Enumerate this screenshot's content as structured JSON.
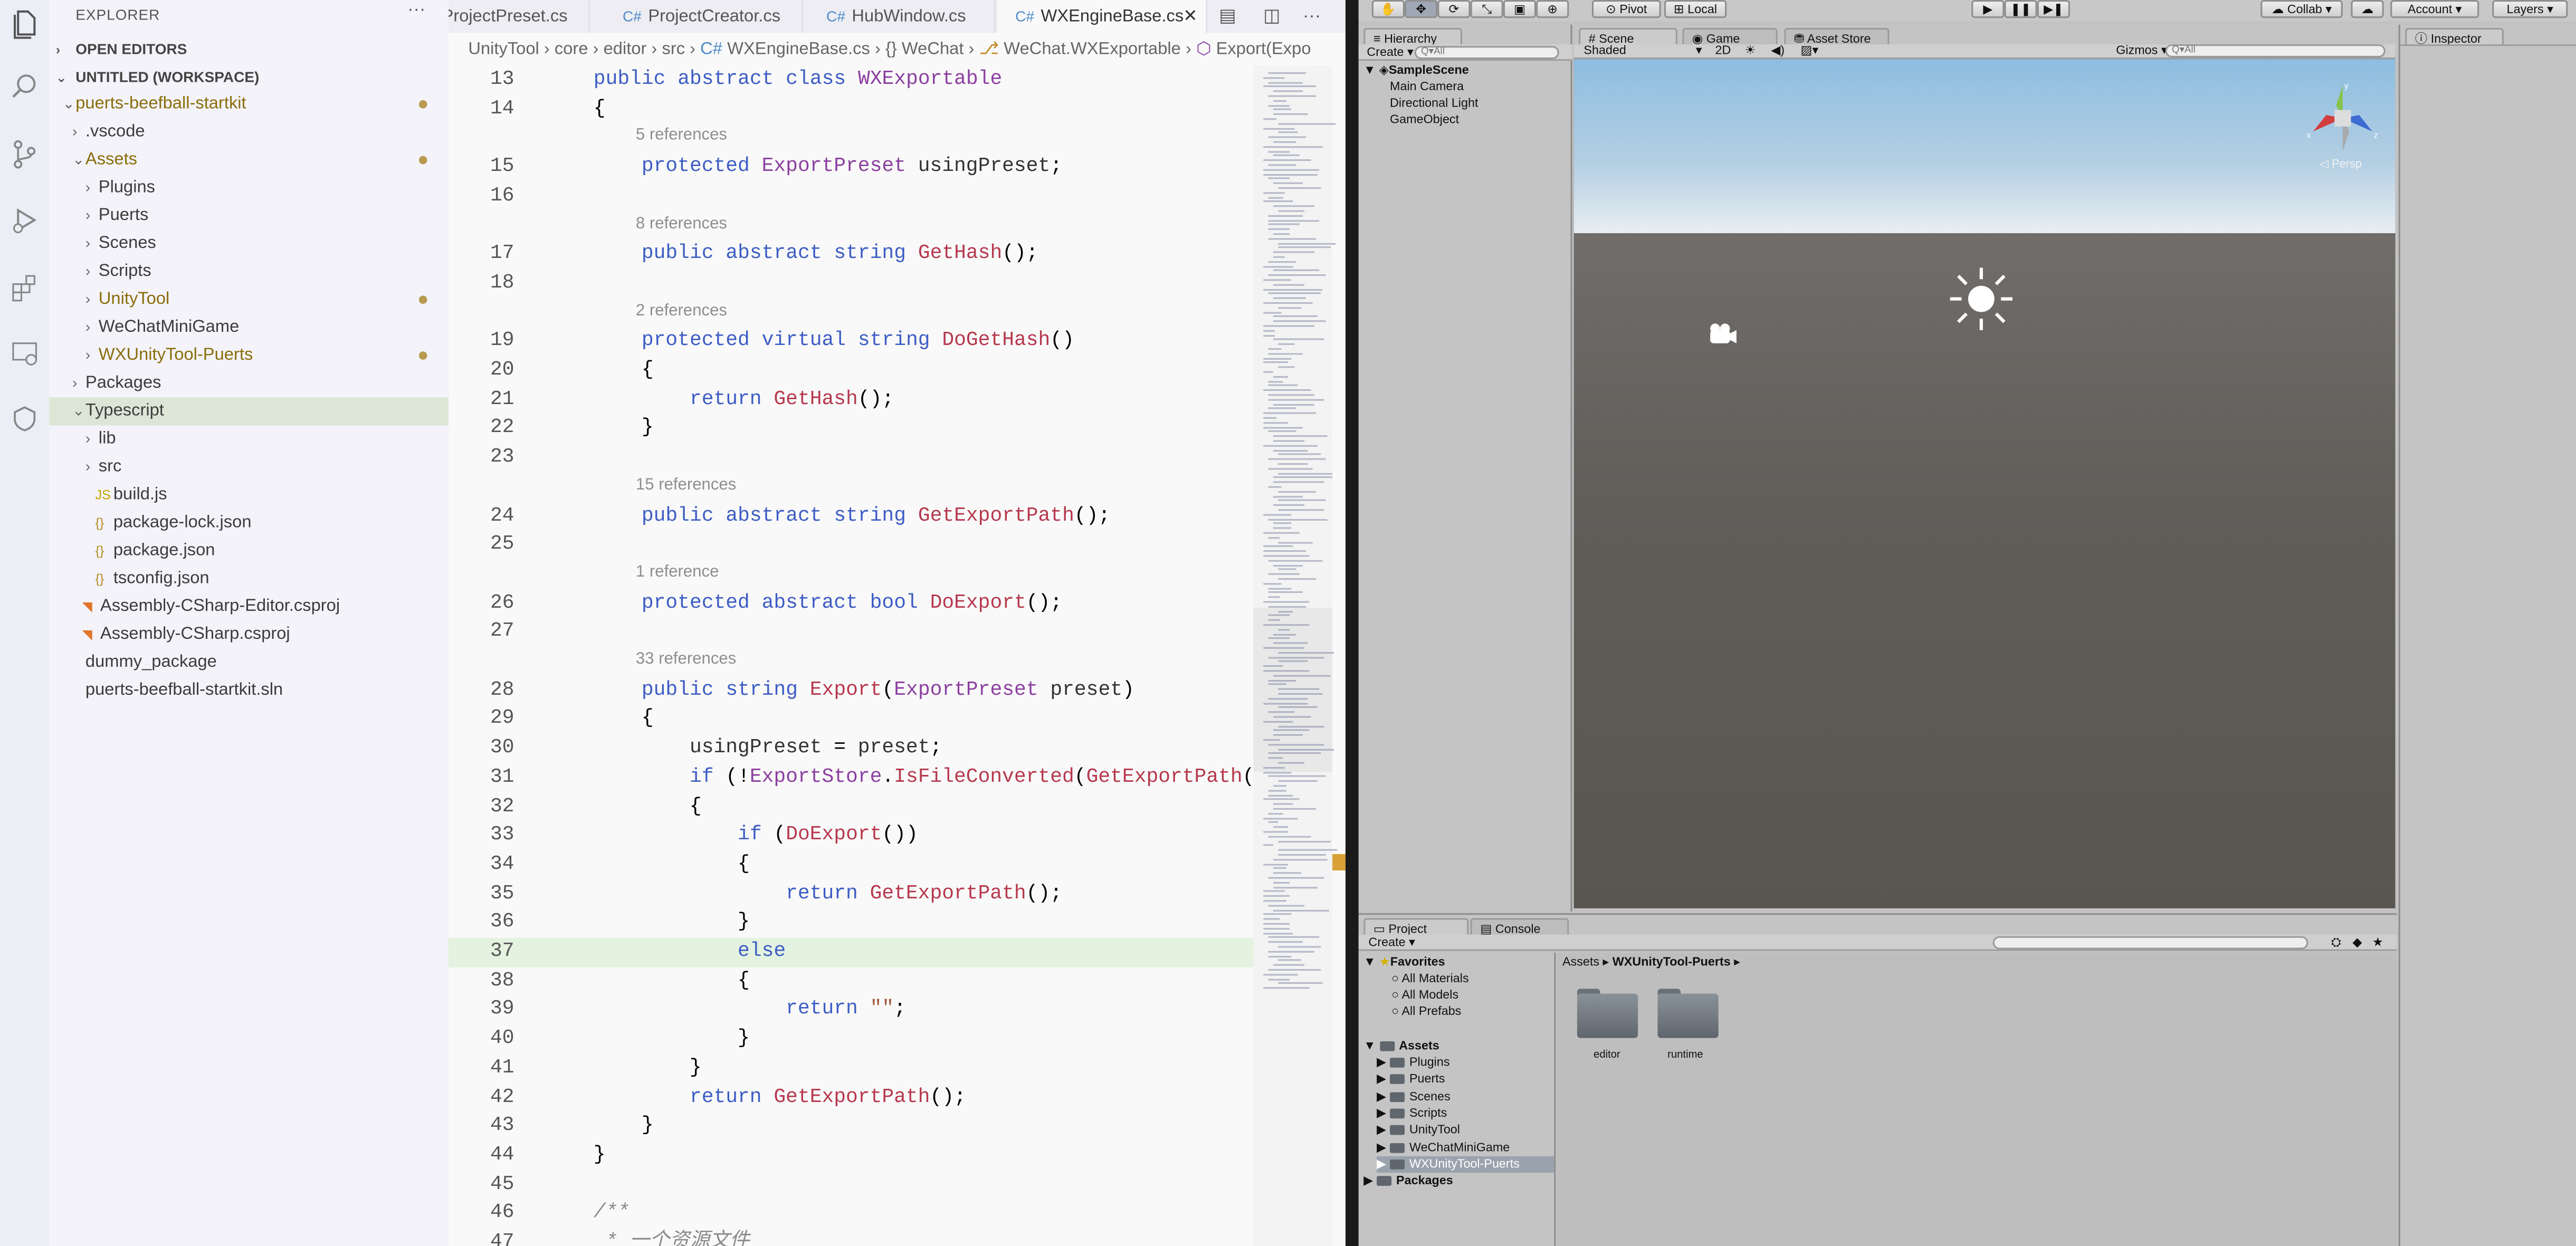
{
  "explorer": {
    "title": "EXPLORER",
    "more": "···",
    "open_editors": "OPEN EDITORS",
    "workspace": "UNTITLED (WORKSPACE)",
    "tree": [
      {
        "label": "puerts-beefball-startkit",
        "indent": 1,
        "chev": "⌄",
        "modified": true
      },
      {
        "label": ".vscode",
        "indent": 2,
        "chev": "›",
        "modified": false
      },
      {
        "label": "Assets",
        "indent": 2,
        "chev": "⌄",
        "modified": true
      },
      {
        "label": "Plugins",
        "indent": 3,
        "chev": "›",
        "modified": false
      },
      {
        "label": "Puerts",
        "indent": 3,
        "chev": "›",
        "modified": false
      },
      {
        "label": "Scenes",
        "indent": 3,
        "chev": "›",
        "modified": false
      },
      {
        "label": "Scripts",
        "indent": 3,
        "chev": "›",
        "modified": false
      },
      {
        "label": "UnityTool",
        "indent": 3,
        "chev": "›",
        "modified": true
      },
      {
        "label": "WeChatMiniGame",
        "indent": 3,
        "chev": "›",
        "modified": false
      },
      {
        "label": "WXUnityTool-Puerts",
        "indent": 3,
        "chev": "›",
        "modified": true
      },
      {
        "label": "Packages",
        "indent": 2,
        "chev": "›",
        "modified": false
      },
      {
        "label": "Typescript",
        "indent": 2,
        "chev": "⌄",
        "modified": false,
        "selected": true
      },
      {
        "label": "lib",
        "indent": 3,
        "chev": "›",
        "modified": false
      },
      {
        "label": "src",
        "indent": 3,
        "chev": "›",
        "modified": false
      },
      {
        "label": "build.js",
        "indent": 3,
        "icon": "JS",
        "modified": false
      },
      {
        "label": "package-lock.json",
        "indent": 3,
        "icon": "{}",
        "modified": false
      },
      {
        "label": "package.json",
        "indent": 3,
        "icon": "{}",
        "modified": false
      },
      {
        "label": "tsconfig.json",
        "indent": 3,
        "icon": "{}",
        "modified": false
      },
      {
        "label": "Assembly-CSharp-Editor.csproj",
        "indent": 2,
        "icon": "rss",
        "modified": false
      },
      {
        "label": "Assembly-CSharp.csproj",
        "indent": 2,
        "icon": "rss",
        "modified": false
      },
      {
        "label": "dummy_package",
        "indent": 2,
        "modified": false
      },
      {
        "label": "puerts-beefball-startkit.sln",
        "indent": 2,
        "modified": false
      }
    ]
  },
  "editor": {
    "tabs": [
      {
        "label": "ProjectPreset.cs",
        "active": false
      },
      {
        "label": "ProjectCreator.cs",
        "active": false
      },
      {
        "label": "HubWindow.cs",
        "active": false
      },
      {
        "label": "WXEngineBase.cs",
        "active": true
      }
    ],
    "breadcrumb": [
      "UnityTool",
      "core",
      "editor",
      "src",
      "WXEngineBase.cs",
      "{} WeChat",
      "WeChat.WXExportable",
      "Export(Expo"
    ],
    "lines": [
      {
        "n": "13",
        "code": "    public abstract class WXExportable"
      },
      {
        "n": "14",
        "code": "    {"
      },
      {
        "n": "15",
        "lens": "5 references",
        "code": "        protected ExportPreset usingPreset;"
      },
      {
        "n": "16",
        "code": ""
      },
      {
        "n": "17",
        "lens": "8 references",
        "code": "        public abstract string GetHash();"
      },
      {
        "n": "18",
        "code": ""
      },
      {
        "n": "19",
        "lens": "2 references",
        "code": "        protected virtual string DoGetHash()"
      },
      {
        "n": "20",
        "code": "        {"
      },
      {
        "n": "21",
        "code": "            return GetHash();"
      },
      {
        "n": "22",
        "code": "        }"
      },
      {
        "n": "23",
        "code": ""
      },
      {
        "n": "24",
        "lens": "15 references",
        "code": "        public abstract string GetExportPath();"
      },
      {
        "n": "25",
        "code": ""
      },
      {
        "n": "26",
        "lens": "1 reference",
        "code": "        protected abstract bool DoExport();"
      },
      {
        "n": "27",
        "code": ""
      },
      {
        "n": "28",
        "lens": "33 references",
        "code": "        public string Export(ExportPreset preset)"
      },
      {
        "n": "29",
        "code": "        {"
      },
      {
        "n": "30",
        "code": "            usingPreset = preset;"
      },
      {
        "n": "31",
        "code": "            if (!ExportStore.IsFileConverted(GetExportPath(),"
      },
      {
        "n": "32",
        "code": "            {"
      },
      {
        "n": "33",
        "code": "                if (DoExport())"
      },
      {
        "n": "34",
        "code": "                {"
      },
      {
        "n": "35",
        "code": "                    return GetExportPath();"
      },
      {
        "n": "36",
        "code": "                }"
      },
      {
        "n": "37",
        "code": "                else",
        "highlight": true
      },
      {
        "n": "38",
        "code": "                {"
      },
      {
        "n": "39",
        "code": "                    return \"\";"
      },
      {
        "n": "40",
        "code": "                }"
      },
      {
        "n": "41",
        "code": "            }"
      },
      {
        "n": "42",
        "code": "            return GetExportPath();"
      },
      {
        "n": "43",
        "code": "        }"
      },
      {
        "n": "44",
        "code": "    }"
      },
      {
        "n": "45",
        "code": ""
      },
      {
        "n": "46",
        "code": "    /**"
      },
      {
        "n": "47",
        "code": "     * 一个资源文件"
      }
    ]
  },
  "unity": {
    "toolbar": {
      "pivot": "Pivot",
      "local": "Local",
      "collab": "Collab ▾",
      "account": "Account ▾",
      "layers": "Layers ▾"
    },
    "hierarchy": {
      "tab": "Hierarchy",
      "create": "Create ▾",
      "search_placeholder": "Q▾All",
      "scene": "SampleScene",
      "items": [
        "Main Camera",
        "Directional Light",
        "GameObject"
      ]
    },
    "scene": {
      "tabs": [
        "Scene",
        "Game",
        "Asset Store"
      ],
      "shading": "Shaded",
      "mode_2d": "2D",
      "gizmos": "Gizmos ▾",
      "search_placeholder": "Q▾All",
      "persp": "◁ Persp"
    },
    "inspector": {
      "tab": "Inspector"
    },
    "project": {
      "tabs": [
        "Project",
        "Console"
      ],
      "create": "Create ▾",
      "favorites": "Favorites",
      "favorite_items": [
        "All Materials",
        "All Models",
        "All Prefabs"
      ],
      "assets": "Assets",
      "asset_folders": [
        "Plugins",
        "Puerts",
        "Scenes",
        "Scripts",
        "UnityTool",
        "WeChatMiniGame",
        "WXUnityTool-Puerts"
      ],
      "packages": "Packages",
      "path": [
        "Assets",
        "WXUnityTool-Puerts"
      ],
      "folders": [
        "editor",
        "runtime"
      ]
    }
  },
  "colors": {
    "modified": "#8a6d0b",
    "selection": "#dde6d6",
    "highlight": "#e4f2e0",
    "keyword": "#3d5dc4",
    "type": "#8b3fa0",
    "function": "#b6384d"
  }
}
